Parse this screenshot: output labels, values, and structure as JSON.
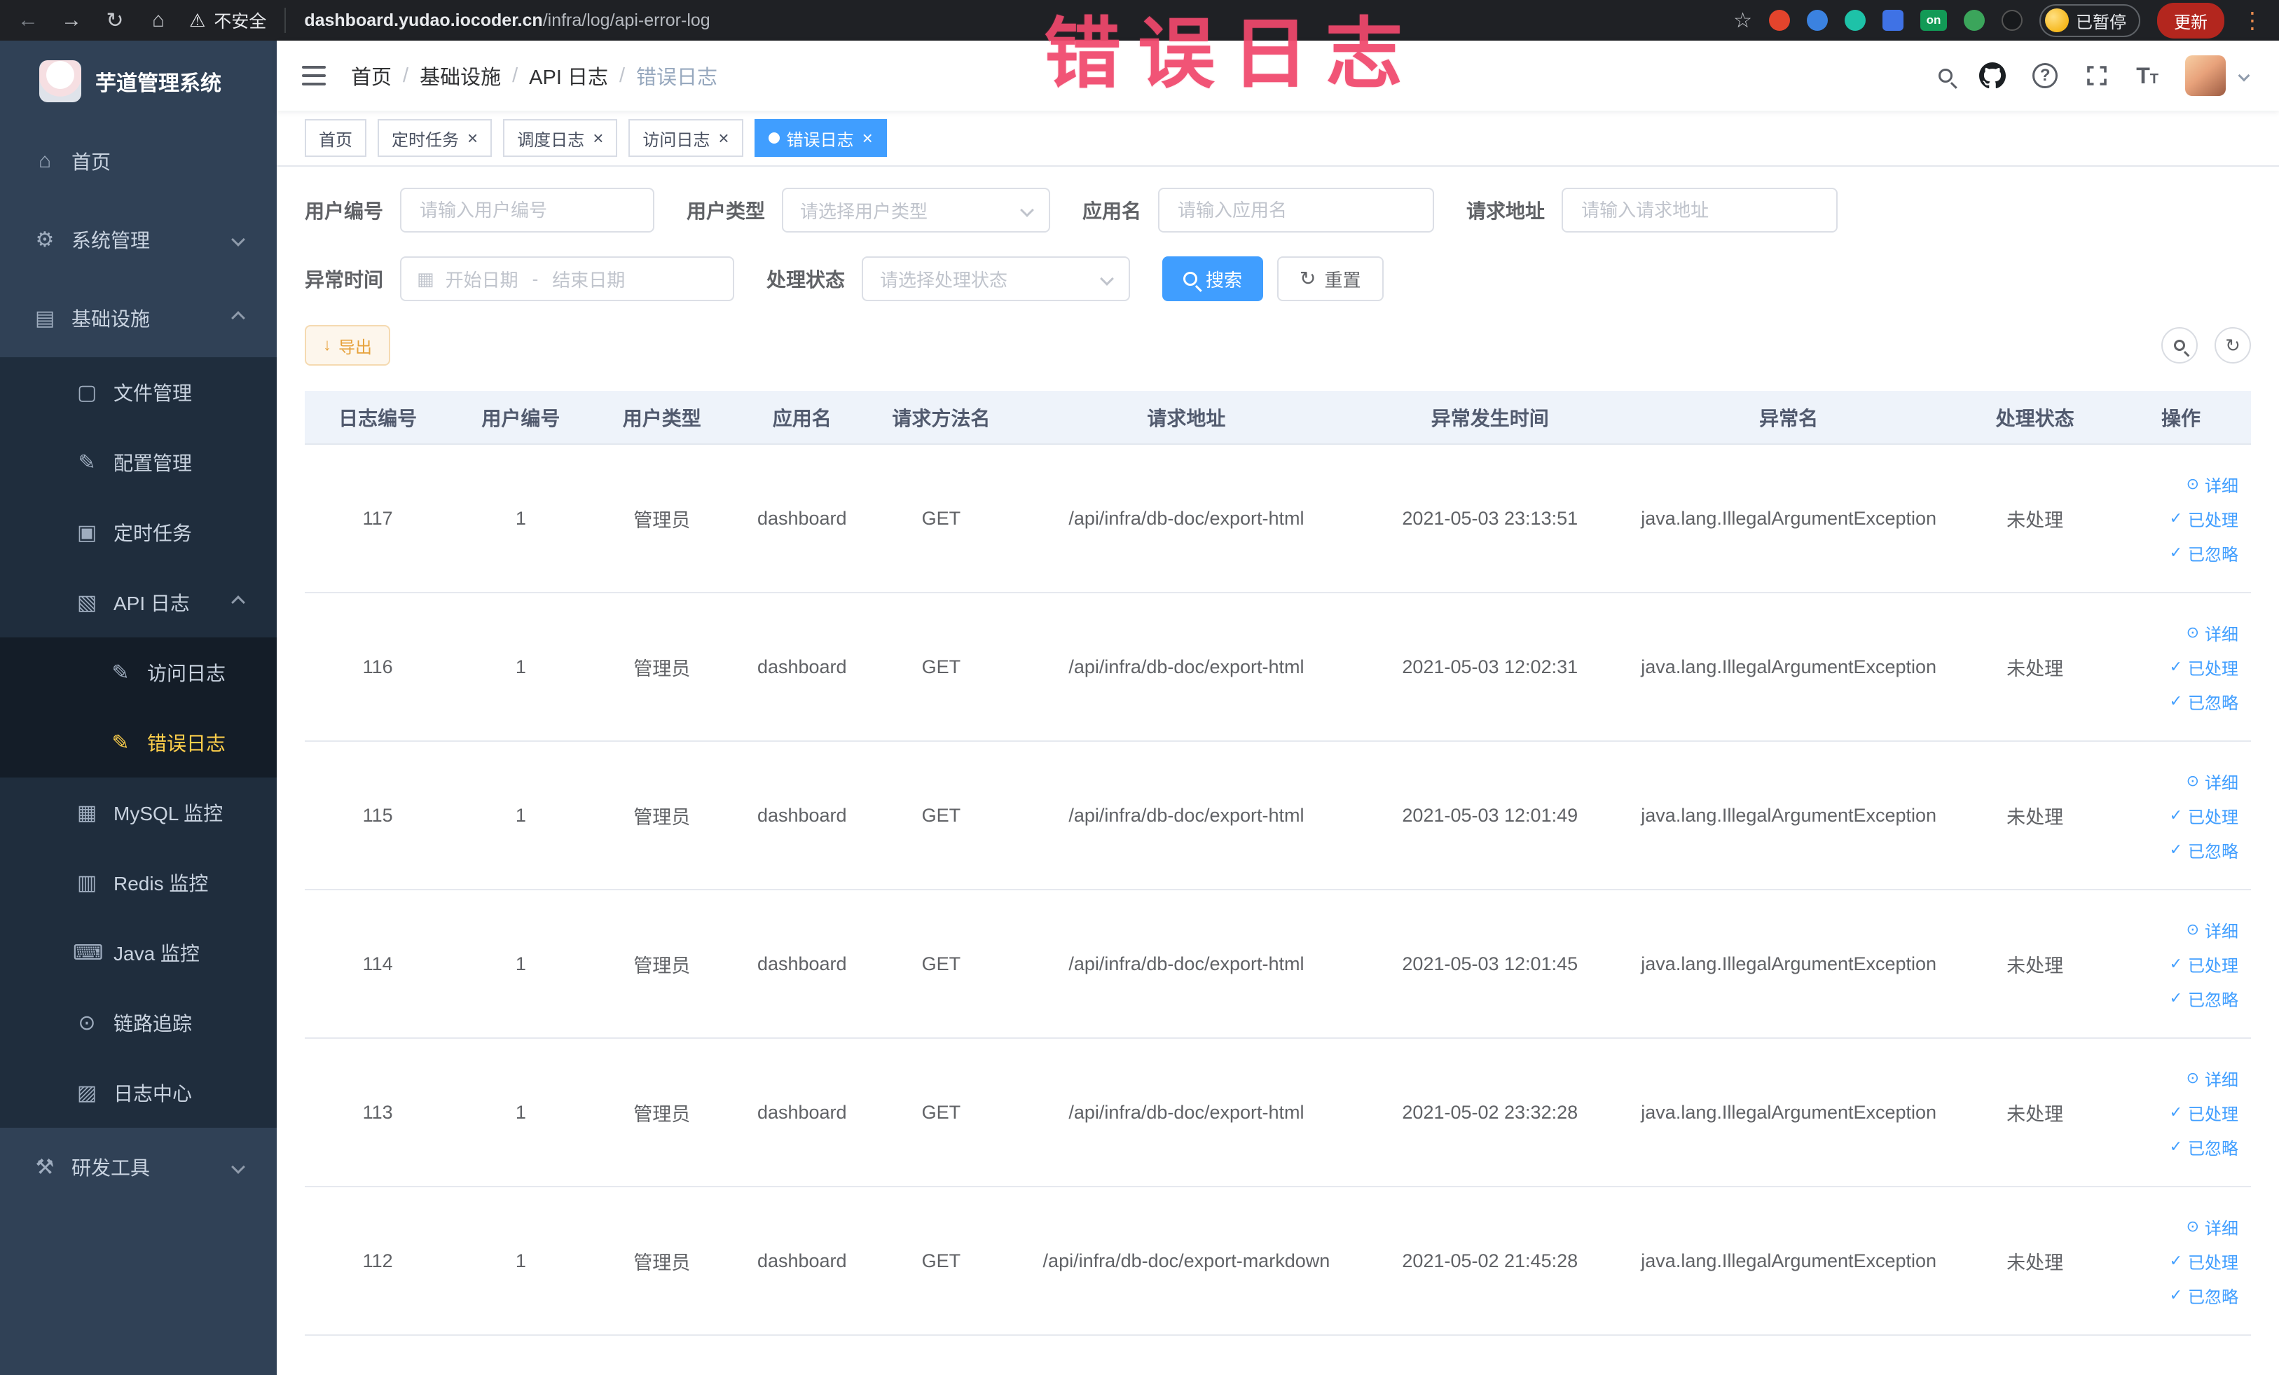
{
  "colors": {
    "accent": "#409eff",
    "sidebar_active": "#ffd04b",
    "warning_text": "#e6a23c",
    "overlay_red": "#f0486c"
  },
  "browser": {
    "security_label": "不安全",
    "url_domain": "dashboard.yudao.iocoder.cn",
    "url_path": "/infra/log/api-error-log",
    "paused_badge": "已暂停",
    "update_button": "更新",
    "extension_badge": "on"
  },
  "overlay": {
    "title": "错误日志"
  },
  "sidebar": {
    "logo_title": "芋道管理系统",
    "items": [
      {
        "label": "首页",
        "icon": "home-icon",
        "level": 1
      },
      {
        "label": "系统管理",
        "icon": "gear-icon",
        "level": 1,
        "arrow": "down"
      },
      {
        "label": "基础设施",
        "icon": "infra-icon",
        "level": 1,
        "arrow": "up"
      },
      {
        "label": "文件管理",
        "icon": "file-icon",
        "level": 2
      },
      {
        "label": "配置管理",
        "icon": "config-icon",
        "level": 2
      },
      {
        "label": "定时任务",
        "icon": "timer-icon",
        "level": 2
      },
      {
        "label": "API 日志",
        "icon": "api-log-icon",
        "level": 2,
        "arrow": "up"
      },
      {
        "label": "访问日志",
        "icon": "access-log-icon",
        "level": 3
      },
      {
        "label": "错误日志",
        "icon": "error-log-icon",
        "level": 3,
        "active": true
      },
      {
        "label": "MySQL 监控",
        "icon": "mysql-icon",
        "level": 2
      },
      {
        "label": "Redis 监控",
        "icon": "redis-icon",
        "level": 2
      },
      {
        "label": "Java 监控",
        "icon": "java-icon",
        "level": 2
      },
      {
        "label": "链路追踪",
        "icon": "trace-icon",
        "level": 2
      },
      {
        "label": "日志中心",
        "icon": "log-center-icon",
        "level": 2
      },
      {
        "label": "研发工具",
        "icon": "tools-icon",
        "level": 1,
        "arrow": "down"
      }
    ]
  },
  "header": {
    "breadcrumb": [
      "首页",
      "基础设施",
      "API 日志",
      "错误日志"
    ]
  },
  "tabs": [
    {
      "label": "首页",
      "closable": false,
      "active": false
    },
    {
      "label": "定时任务",
      "closable": true,
      "active": false
    },
    {
      "label": "调度日志",
      "closable": true,
      "active": false
    },
    {
      "label": "访问日志",
      "closable": true,
      "active": false
    },
    {
      "label": "错误日志",
      "closable": true,
      "active": true
    }
  ],
  "filters": {
    "user_id": {
      "label": "用户编号",
      "placeholder": "请输入用户编号"
    },
    "user_type": {
      "label": "用户类型",
      "placeholder": "请选择用户类型"
    },
    "app_name": {
      "label": "应用名",
      "placeholder": "请输入应用名"
    },
    "request_url": {
      "label": "请求地址",
      "placeholder": "请输入请求地址"
    },
    "exception_time": {
      "label": "异常时间",
      "start_placeholder": "开始日期",
      "separator": "-",
      "end_placeholder": "结束日期"
    },
    "process_status": {
      "label": "处理状态",
      "placeholder": "请选择处理状态"
    },
    "search_button": "搜索",
    "reset_button": "重置"
  },
  "toolbar": {
    "export_button": "导出"
  },
  "table": {
    "columns": [
      "日志编号",
      "用户编号",
      "用户类型",
      "应用名",
      "请求方法名",
      "请求地址",
      "异常发生时间",
      "异常名",
      "处理状态",
      "操作"
    ],
    "actions": [
      "详细",
      "已处理",
      "已忽略"
    ],
    "rows": [
      {
        "id": "117",
        "user_id": "1",
        "user_type": "管理员",
        "app": "dashboard",
        "method": "GET",
        "url": "/api/infra/db-doc/export-html",
        "time": "2021-05-03 23:13:51",
        "exception": "java.lang.IllegalArgumentException",
        "status": "未处理"
      },
      {
        "id": "116",
        "user_id": "1",
        "user_type": "管理员",
        "app": "dashboard",
        "method": "GET",
        "url": "/api/infra/db-doc/export-html",
        "time": "2021-05-03 12:02:31",
        "exception": "java.lang.IllegalArgumentException",
        "status": "未处理"
      },
      {
        "id": "115",
        "user_id": "1",
        "user_type": "管理员",
        "app": "dashboard",
        "method": "GET",
        "url": "/api/infra/db-doc/export-html",
        "time": "2021-05-03 12:01:49",
        "exception": "java.lang.IllegalArgumentException",
        "status": "未处理"
      },
      {
        "id": "114",
        "user_id": "1",
        "user_type": "管理员",
        "app": "dashboard",
        "method": "GET",
        "url": "/api/infra/db-doc/export-html",
        "time": "2021-05-03 12:01:45",
        "exception": "java.lang.IllegalArgumentException",
        "status": "未处理"
      },
      {
        "id": "113",
        "user_id": "1",
        "user_type": "管理员",
        "app": "dashboard",
        "method": "GET",
        "url": "/api/infra/db-doc/export-html",
        "time": "2021-05-02 23:32:28",
        "exception": "java.lang.IllegalArgumentException",
        "status": "未处理"
      },
      {
        "id": "112",
        "user_id": "1",
        "user_type": "管理员",
        "app": "dashboard",
        "method": "GET",
        "url": "/api/infra/db-doc/export-markdown",
        "time": "2021-05-02 21:45:28",
        "exception": "java.lang.IllegalArgumentException",
        "status": "未处理"
      }
    ]
  }
}
